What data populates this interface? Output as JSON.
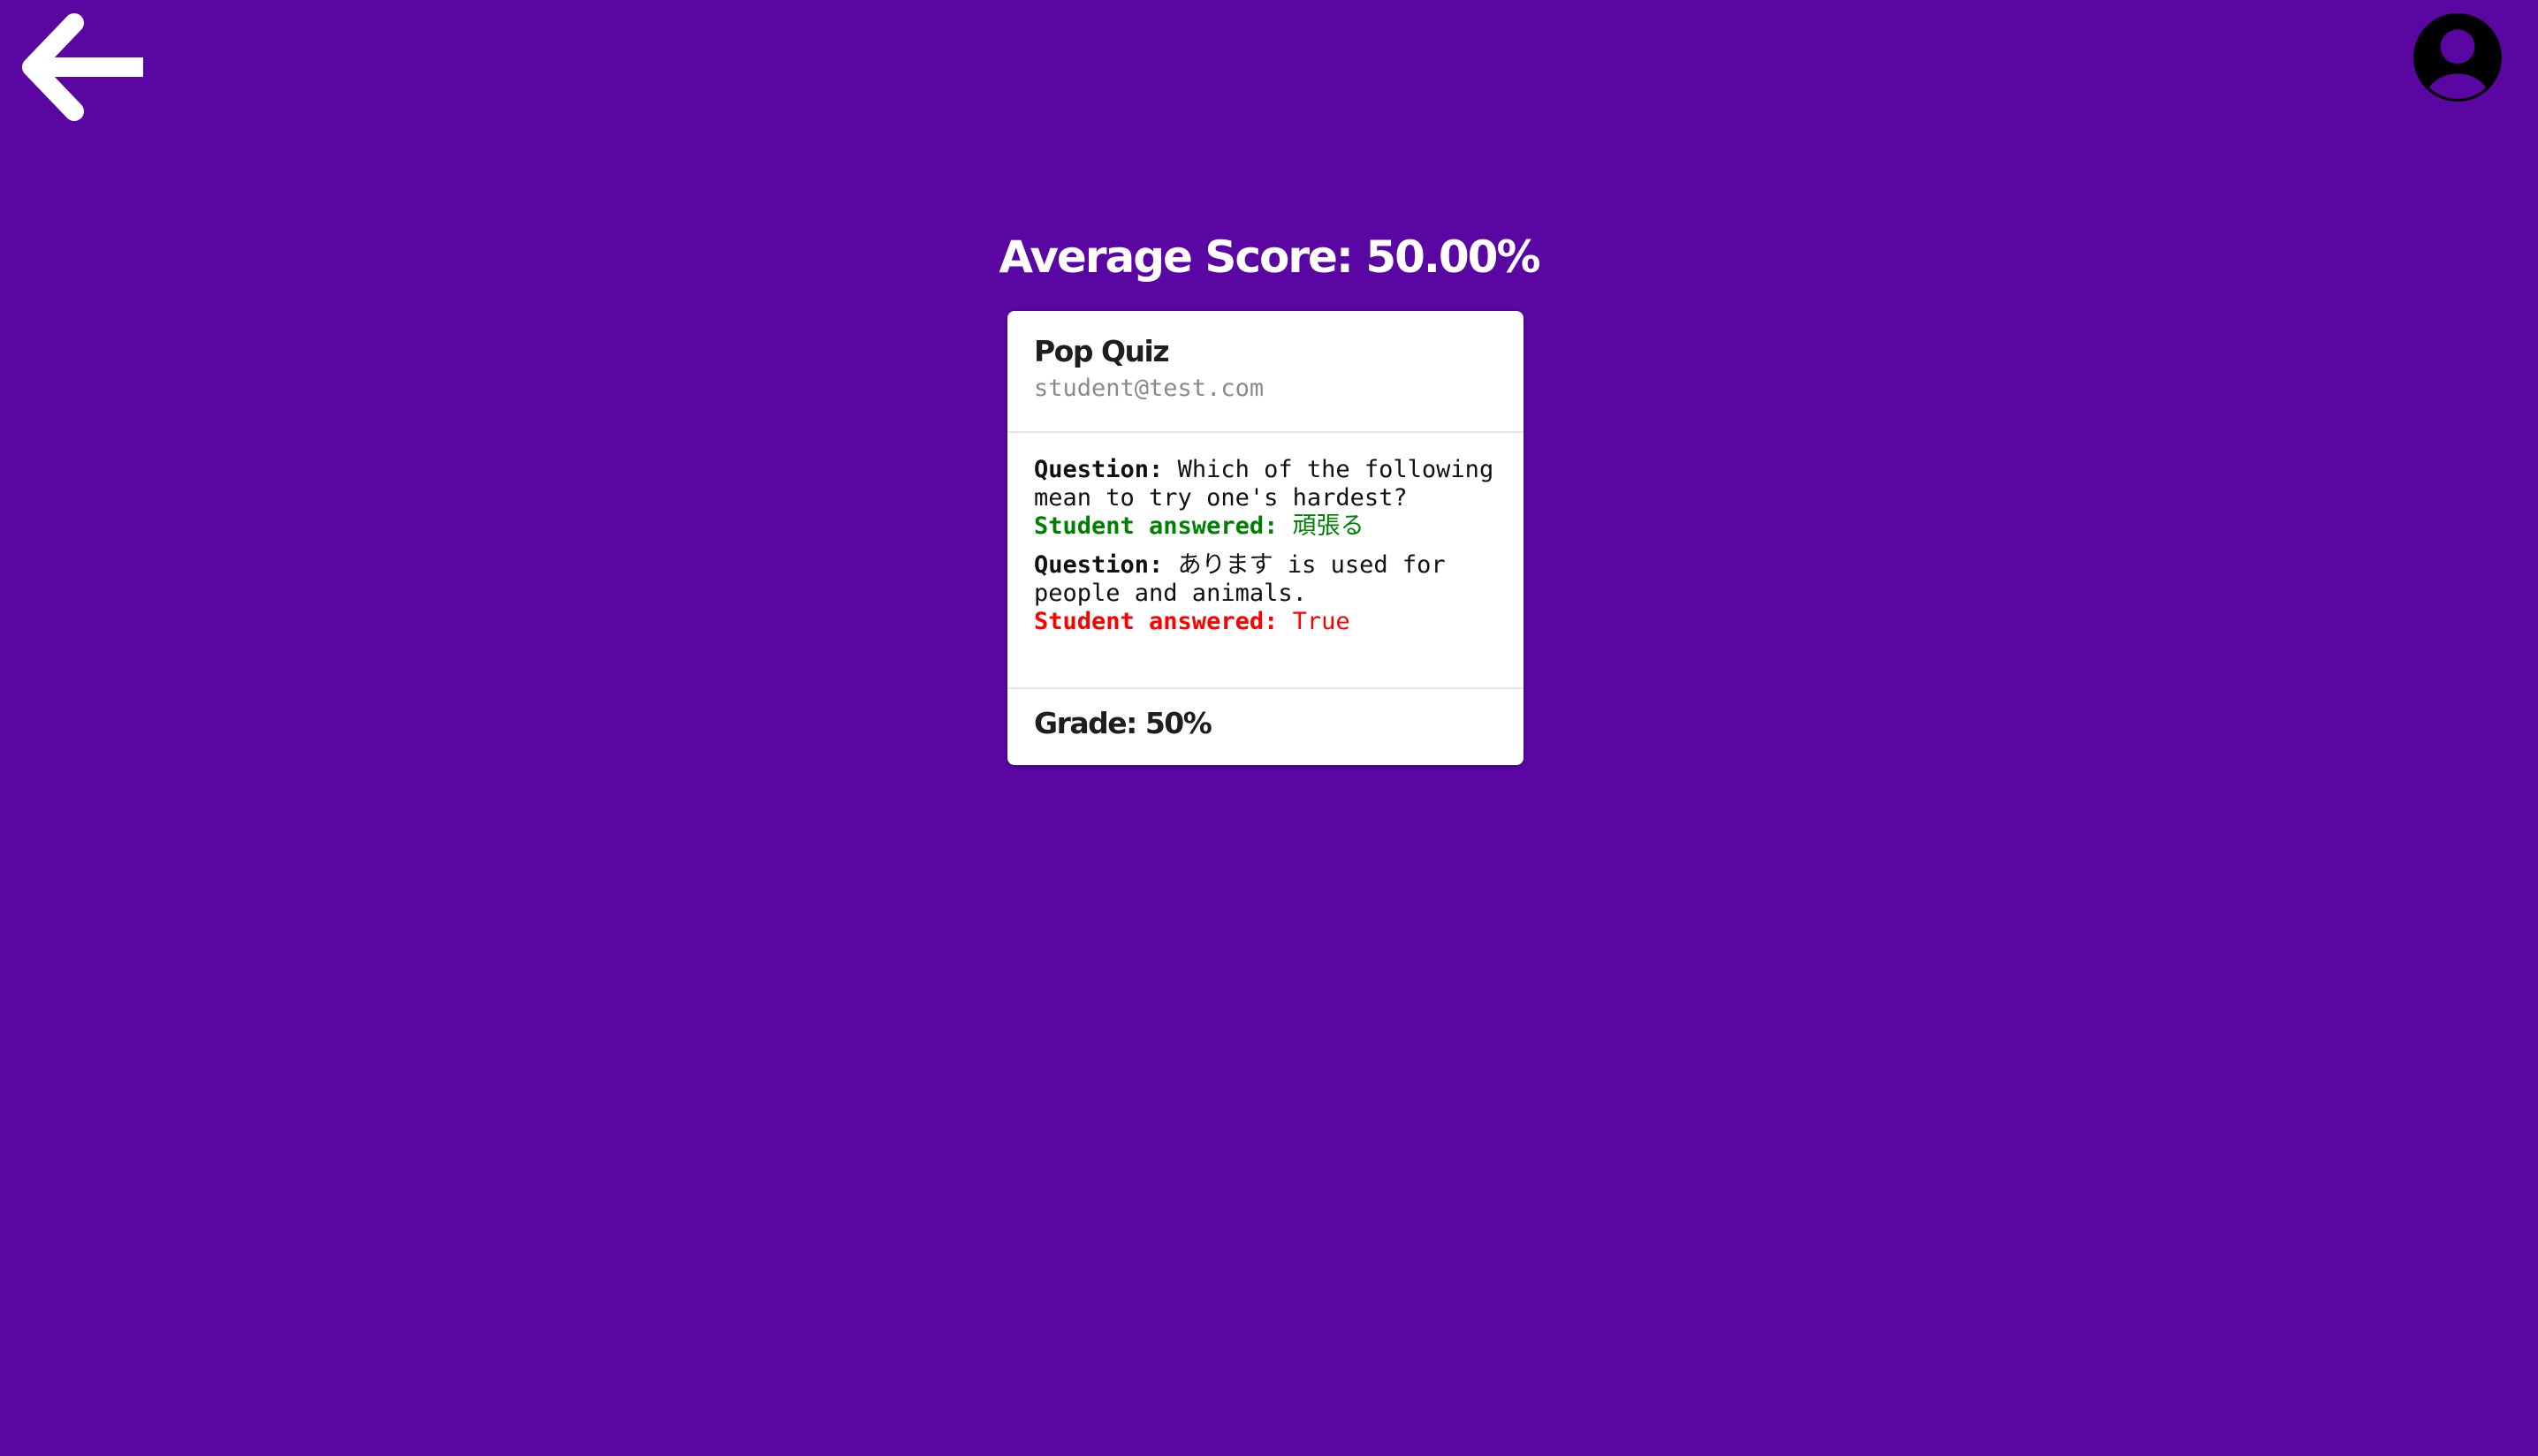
{
  "nav": {
    "back_icon": "arrow-left-icon",
    "profile_icon": "user-circle-icon"
  },
  "summary": {
    "average_score": "Average Score: 50.00%"
  },
  "submission": {
    "quiz_title": "Pop Quiz",
    "student_email": "student@test.com",
    "question_label": "Question:",
    "answer_label": "Student answered:",
    "items": [
      {
        "question": "Which of the following mean to try one's hardest?",
        "answer": "頑張る",
        "correct": true
      },
      {
        "question": "あります is used for people and animals.",
        "answer": "True",
        "correct": false
      }
    ],
    "grade": "Grade: 50%"
  },
  "colors": {
    "background": "#5906a3",
    "correct": "#008000",
    "incorrect": "#ff0000"
  }
}
